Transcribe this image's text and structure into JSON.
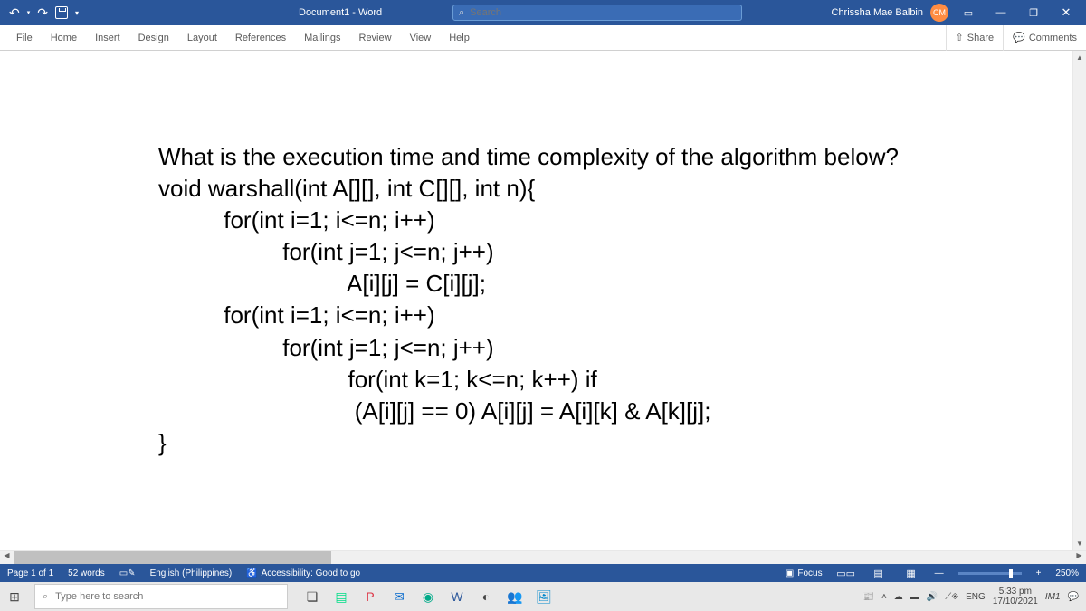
{
  "titlebar": {
    "doc_title": "Document1 - Word",
    "search_placeholder": "Search",
    "user_name": "Chrissha Mae Balbin",
    "user_initials": "CM"
  },
  "ribbon": {
    "tabs": [
      "File",
      "Home",
      "Insert",
      "Design",
      "Layout",
      "References",
      "Mailings",
      "Review",
      "View",
      "Help"
    ],
    "share": "Share",
    "comments": "Comments"
  },
  "document": {
    "lines": [
      "What is the execution time and time complexity of the algorithm below?",
      "void warshall(int A[][], int C[][], int n){",
      "          for(int i=1; i<=n; i++)",
      "                   for(int j=1; j<=n; j++)",
      "                             A[i][j] = C[i][j];",
      "",
      "          for(int i=1; i<=n; i++)",
      "                   for(int j=1; j<=n; j++)",
      "                             for(int k=1; k<=n; k++) if",
      "                              (A[i][j] == 0) A[i][j] = A[i][k] & A[k][j];",
      "}"
    ]
  },
  "statusbar": {
    "page_info": "Page 1 of 1",
    "word_count": "52 words",
    "language": "English (Philippines)",
    "accessibility": "Accessibility: Good to go",
    "focus": "Focus",
    "zoom": "250%"
  },
  "taskbar": {
    "search_placeholder": "Type here to search",
    "lang": "ENG",
    "time": "5:33 pm",
    "date": "17/10/2021",
    "ime": "IM1"
  }
}
